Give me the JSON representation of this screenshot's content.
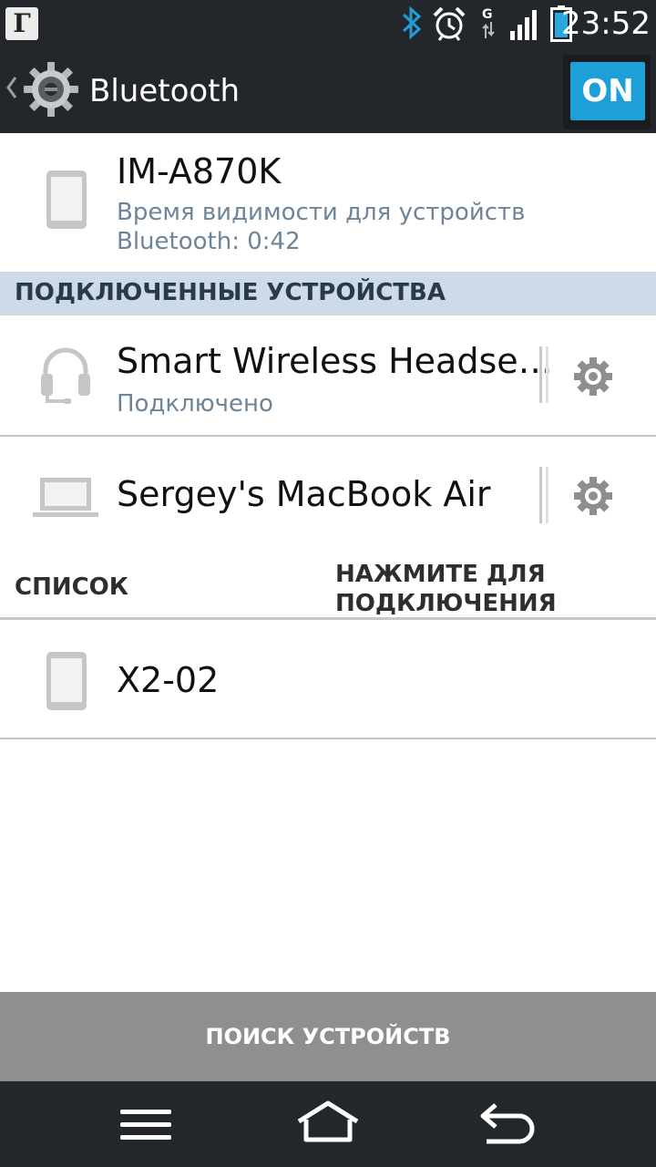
{
  "status_bar": {
    "notification_glyph": "Г",
    "network": "G",
    "time": "23:52",
    "icons": [
      "bluetooth-icon",
      "alarm-icon",
      "signal-icon",
      "battery-icon"
    ],
    "colors": {
      "bluetooth": "#1e9fd7",
      "battery": "#29a9e0"
    }
  },
  "action_bar": {
    "title": "Bluetooth",
    "toggle_label": "ON",
    "icons": [
      "back-chevron-icon",
      "settings-gear-icon"
    ],
    "accent": "#1e9fd7"
  },
  "this_device": {
    "name": "IM-A870K",
    "visibility_line1": "Время видимости для устройств",
    "visibility_line2": "Bluetooth: 0:42",
    "icon": "phone-icon"
  },
  "connected_section": {
    "header": "ПОДКЛЮЧЕННЫЕ УСТРОЙСТВА",
    "devices": [
      {
        "name": "Smart Wireless Headse…",
        "status": "Подключено",
        "icon": "headset-icon"
      },
      {
        "name": "Sergey's MacBook Air",
        "status": "",
        "icon": "laptop-icon"
      }
    ]
  },
  "list_section": {
    "header_left": "СПИСОК",
    "header_right_line1": "НАЖМИТЕ ДЛЯ",
    "header_right_line2": "ПОДКЛЮЧЕНИЯ",
    "devices": [
      {
        "name": "X2-02",
        "icon": "phone-icon"
      }
    ]
  },
  "search_button": "ПОИСК УСТРОЙСТВ",
  "nav_bar": {
    "icons": [
      "menu-icon",
      "home-icon",
      "back-icon"
    ]
  }
}
